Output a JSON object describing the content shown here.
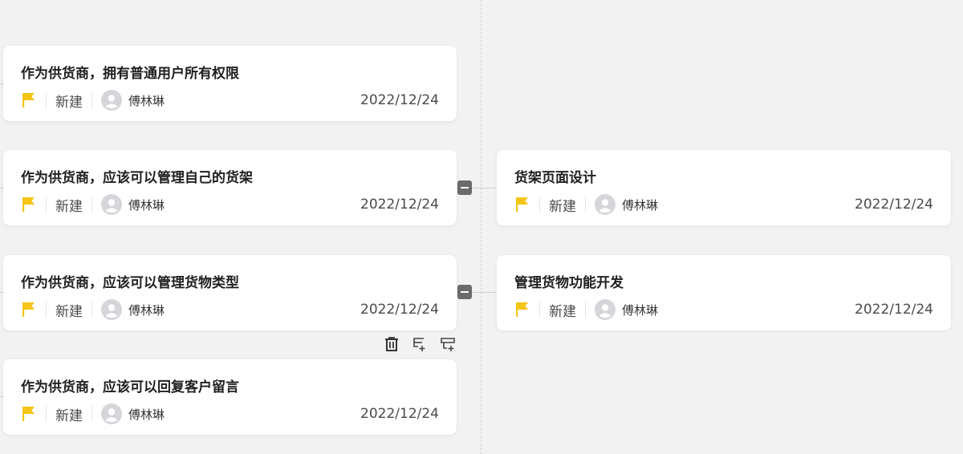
{
  "cards_left": [
    {
      "title": "作为供货商，拥有普通用户所有权限",
      "status": "新建",
      "owner": "傅林琳",
      "date": "2022/12/24"
    },
    {
      "title": "作为供货商，应该可以管理自己的货架",
      "status": "新建",
      "owner": "傅林琳",
      "date": "2022/12/24"
    },
    {
      "title": "作为供货商，应该可以管理货物类型",
      "status": "新建",
      "owner": "傅林琳",
      "date": "2022/12/24"
    },
    {
      "title": "作为供货商，应该可以回复客户留言",
      "status": "新建",
      "owner": "傅林琳",
      "date": "2022/12/24"
    }
  ],
  "cards_right": [
    {
      "title": "货架页面设计",
      "status": "新建",
      "owner": "傅林琳",
      "date": "2022/12/24"
    },
    {
      "title": "管理货物功能开发",
      "status": "新建",
      "owner": "傅林琳",
      "date": "2022/12/24"
    }
  ],
  "icons": {
    "flag": "flag-icon",
    "avatar": "user-avatar-icon",
    "collapse": "minus-icon",
    "delete": "trash-icon",
    "add_sibling": "add-sibling-node-icon",
    "add_child": "add-child-node-icon"
  },
  "colors": {
    "flag": "#f5c518",
    "collapse_button": "#6b6b6b",
    "background": "#f2f2f3"
  }
}
